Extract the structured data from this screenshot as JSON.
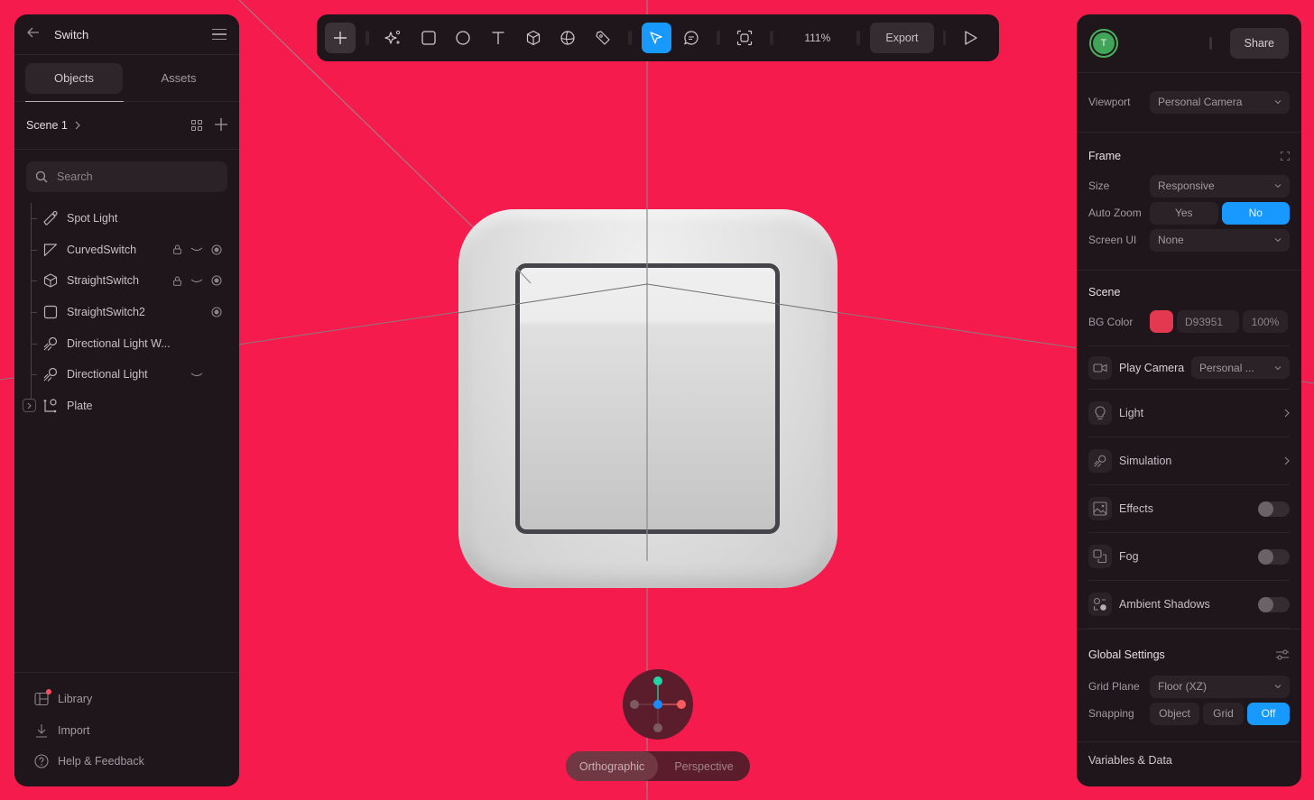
{
  "app": {
    "project_title": "Switch"
  },
  "left_panel": {
    "tabs": [
      {
        "label": "Objects",
        "active": true
      },
      {
        "label": "Assets",
        "active": false
      }
    ],
    "scene": {
      "name": "Scene 1"
    },
    "search": {
      "placeholder": "Search",
      "value": ""
    },
    "objects": [
      {
        "label": "Spot Light",
        "icon": "spotlight-icon",
        "locked": false,
        "hidden": false,
        "target": false
      },
      {
        "label": "CurvedSwitch",
        "icon": "curved-shape-icon",
        "locked": true,
        "hidden": true,
        "target": true
      },
      {
        "label": "StraightSwitch",
        "icon": "cube-icon",
        "locked": true,
        "hidden": true,
        "target": true
      },
      {
        "label": "StraightSwitch2",
        "icon": "square-icon",
        "locked": false,
        "hidden": false,
        "target": true
      },
      {
        "label": "Directional Light W...",
        "icon": "directional-light-icon",
        "locked": false,
        "hidden": false,
        "target": false
      },
      {
        "label": "Directional Light",
        "icon": "directional-light-icon",
        "locked": false,
        "hidden": true,
        "target": false
      },
      {
        "label": "Plate",
        "icon": "group-icon",
        "locked": false,
        "hidden": false,
        "target": false,
        "expandable": true
      }
    ],
    "footer": [
      {
        "label": "Library",
        "icon": "library-icon",
        "notification": true
      },
      {
        "label": "Import",
        "icon": "download-icon"
      },
      {
        "label": "Help & Feedback",
        "icon": "help-icon"
      }
    ]
  },
  "toolbar": {
    "tools": [
      "add",
      "ai-sparkle",
      "rectangle",
      "ellipse",
      "text",
      "cube",
      "sphere",
      "pen",
      "select",
      "comment",
      "frame-capture"
    ],
    "active_tool": "select",
    "zoom": "111%",
    "export_label": "Export",
    "play_label": "Play"
  },
  "right_panel": {
    "user_initial": "T",
    "share_label": "Share",
    "viewport": {
      "label": "Viewport",
      "value": "Personal Camera"
    },
    "frame": {
      "title": "Frame",
      "size": {
        "label": "Size",
        "value": "Responsive"
      },
      "auto_zoom": {
        "label": "Auto Zoom",
        "options": [
          "Yes",
          "No"
        ],
        "selected": "No"
      },
      "screen_ui": {
        "label": "Screen UI",
        "value": "None"
      }
    },
    "scene": {
      "title": "Scene",
      "bg_color": {
        "label": "BG Color",
        "hex": "D93951",
        "opacity": "100%",
        "swatch": "#e3384f"
      },
      "play_camera": {
        "label": "Play Camera",
        "value": "Personal ..."
      }
    },
    "features": [
      {
        "label": "Light",
        "icon": "bulb-icon",
        "control": "chevron"
      },
      {
        "label": "Simulation",
        "icon": "simulation-icon",
        "control": "chevron"
      },
      {
        "label": "Effects",
        "icon": "image-icon",
        "control": "toggle",
        "on": false
      },
      {
        "label": "Fog",
        "icon": "fog-icon",
        "control": "toggle",
        "on": false
      },
      {
        "label": "Ambient Shadows",
        "icon": "ambient-shadow-icon",
        "control": "toggle",
        "on": false
      }
    ],
    "global_settings": {
      "title": "Global Settings",
      "grid_plane": {
        "label": "Grid Plane",
        "value": "Floor (XZ)"
      },
      "snapping": {
        "label": "Snapping",
        "options": [
          "Object",
          "Grid",
          "Off"
        ],
        "selected": "Off"
      }
    },
    "next_section_title": "Variables & Data"
  },
  "viewport": {
    "view_modes": [
      "Orthographic",
      "Perspective"
    ],
    "active_view_mode": "Orthographic",
    "background": "#f61b4d"
  }
}
